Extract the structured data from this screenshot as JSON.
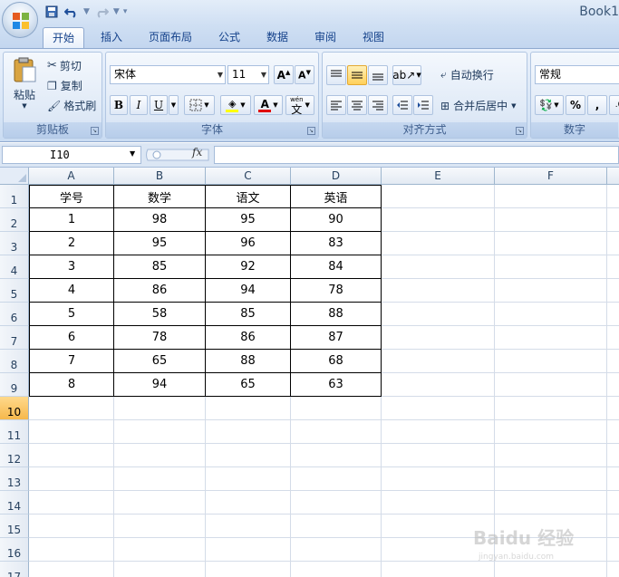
{
  "window": {
    "title": "Book1"
  },
  "tabs": [
    {
      "label": "开始",
      "active": true
    },
    {
      "label": "插入"
    },
    {
      "label": "页面布局"
    },
    {
      "label": "公式"
    },
    {
      "label": "数据"
    },
    {
      "label": "审阅"
    },
    {
      "label": "视图"
    }
  ],
  "clipboard": {
    "paste": "粘贴",
    "cut": "剪切",
    "copy": "复制",
    "format_painter": "格式刷",
    "group_label": "剪贴板"
  },
  "font": {
    "font_name": "宋体",
    "font_size": "11",
    "bold": "B",
    "italic": "I",
    "underline": "U",
    "phonetic": "wén",
    "group_label": "字体"
  },
  "alignment": {
    "wrap_text": "自动换行",
    "merge_center": "合并后居中",
    "group_label": "对齐方式"
  },
  "number": {
    "format": "常规",
    "percent": "%",
    "comma": ",",
    "group_label": "数字"
  },
  "formula_bar": {
    "name_box": "I10",
    "fx": "fx",
    "value": ""
  },
  "sheet": {
    "columns": [
      "A",
      "B",
      "C",
      "D",
      "E",
      "F"
    ],
    "rows": [
      "1",
      "2",
      "3",
      "4",
      "5",
      "6",
      "7",
      "8",
      "9",
      "10",
      "11",
      "12",
      "13",
      "14",
      "15",
      "16",
      "17"
    ],
    "selected_row": "10",
    "table": [
      [
        "学号",
        "数学",
        "语文",
        "英语"
      ],
      [
        "1",
        "98",
        "95",
        "90"
      ],
      [
        "2",
        "95",
        "96",
        "83"
      ],
      [
        "3",
        "85",
        "92",
        "84"
      ],
      [
        "4",
        "86",
        "94",
        "78"
      ],
      [
        "5",
        "58",
        "85",
        "88"
      ],
      [
        "6",
        "78",
        "86",
        "87"
      ],
      [
        "7",
        "65",
        "88",
        "68"
      ],
      [
        "8",
        "94",
        "65",
        "63"
      ]
    ]
  },
  "watermark": {
    "text": "Baidu 经验",
    "sub": "jingyan.baidu.com"
  },
  "colors": {
    "accent": "#15428b",
    "selected_row": "#f6b84c",
    "font_color": "#e00000",
    "highlight": "#ffff00"
  }
}
